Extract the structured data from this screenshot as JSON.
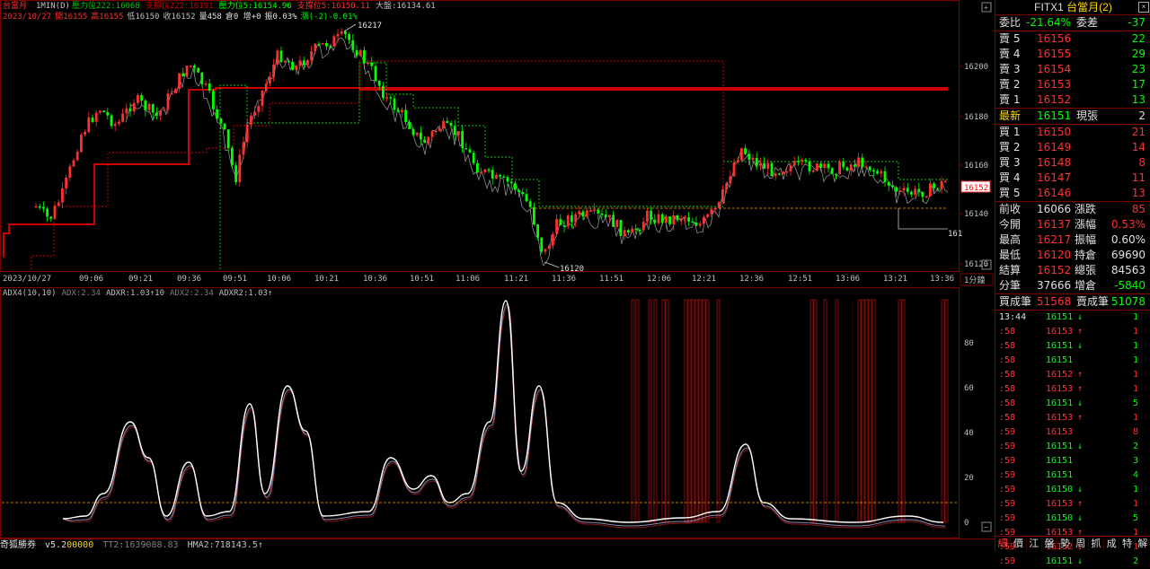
{
  "main": {
    "contract": "台當月",
    "interval": "1MIN(D)",
    "header_items": [
      {
        "text": "壓力位222:16068",
        "color": "#00c000"
      },
      {
        "text": "支撐位222:16191",
        "color": "#cc0000"
      },
      {
        "text": "壓力位5:16154.96",
        "color": "#00ff00"
      },
      {
        "text": "支撐位5:16150.11",
        "color": "#ff3030"
      },
      {
        "text": "大盤:16134.61",
        "color": "#c0c0c0"
      }
    ],
    "info_line": {
      "date": "2023/10/27",
      "open": "開16155",
      "high": "高16155",
      "low": "低16150",
      "close": "收16152",
      "volume": "量458",
      "oi": "倉0 增+0",
      "amplitude": "振0.03%",
      "change": "漲(-2)-0.01%"
    },
    "price_axis": [
      "16200",
      "16180",
      "16160",
      "16140",
      "16120"
    ],
    "time_axis": [
      "2023/10/27",
      "09:06",
      "09:21",
      "09:36",
      "09:51",
      "10:06",
      "10:21",
      "10:36",
      "10:51",
      "11:06",
      "11:21",
      "11:36",
      "11:51",
      "12:06",
      "12:21",
      "12:36",
      "12:51",
      "13:06",
      "13:21",
      "13:36"
    ],
    "interval_label": "1分鐘",
    "current_price_tag": "16152",
    "right_edge_label": "161",
    "high_marker": "16217",
    "low_marker": "16120"
  },
  "indicator": {
    "items": [
      {
        "text": "ADX4(10,10)",
        "color": "#c0c0c0"
      },
      {
        "text": "ADX:2.34",
        "color": "#808080"
      },
      {
        "text": "ADXR:1.03↑10",
        "color": "#c0c0c0"
      },
      {
        "text": "ADX2:2.34",
        "color": "#808080"
      },
      {
        "text": "ADXR2:1.03↑",
        "color": "#c0c0c0"
      }
    ],
    "axis": [
      "80",
      "60",
      "40",
      "20",
      "0"
    ]
  },
  "status": {
    "app": "奇狐勝券",
    "version": "v5.2",
    "version_suffix": "00000",
    "tt": "TT2:1639088.83",
    "hma": "HMA2:718143.5↑"
  },
  "panel": {
    "title_prefix": "FITX1",
    "title_name": "台當月(2)",
    "ratio": {
      "label1": "委比",
      "value1": "-21.64%",
      "label2": "委差",
      "value2": "-37"
    },
    "asks": [
      {
        "label": "賣 5",
        "price": "16156",
        "vol": "22"
      },
      {
        "label": "賣 4",
        "price": "16155",
        "vol": "29"
      },
      {
        "label": "賣 3",
        "price": "16154",
        "vol": "23"
      },
      {
        "label": "賣 2",
        "price": "16153",
        "vol": "17"
      },
      {
        "label": "賣 1",
        "price": "16152",
        "vol": "13"
      }
    ],
    "last": {
      "label": "最新",
      "price": "16151",
      "label2": "現張",
      "vol": "2"
    },
    "bids": [
      {
        "label": "買 1",
        "price": "16150",
        "vol": "21"
      },
      {
        "label": "買 2",
        "price": "16149",
        "vol": "14"
      },
      {
        "label": "買 3",
        "price": "16148",
        "vol": "8"
      },
      {
        "label": "買 4",
        "price": "16147",
        "vol": "11"
      },
      {
        "label": "買 5",
        "price": "16146",
        "vol": "13"
      }
    ],
    "stats": [
      {
        "l1": "前收",
        "v1": "16066",
        "c1": "#e0e0e0",
        "l2": "漲跌",
        "v2": "85",
        "c2": "#ff3030"
      },
      {
        "l1": "今開",
        "v1": "16137",
        "c1": "#ff3030",
        "l2": "漲幅",
        "v2": "0.53%",
        "c2": "#ff3030"
      },
      {
        "l1": "最高",
        "v1": "16217",
        "c1": "#ff3030",
        "l2": "振幅",
        "v2": "0.60%",
        "c2": "#e0e0e0"
      },
      {
        "l1": "最低",
        "v1": "16120",
        "c1": "#ff3030",
        "l2": "持倉",
        "v2": "69690",
        "c2": "#e0e0e0"
      },
      {
        "l1": "結算",
        "v1": "16152",
        "c1": "#ff3030",
        "l2": "總張",
        "v2": "84563",
        "c2": "#e0e0e0"
      },
      {
        "l1": "分筆",
        "v1": "37666",
        "c1": "#e0e0e0",
        "l2": "增倉",
        "v2": "-5840",
        "c2": "#00ff00"
      }
    ],
    "trade_summary": {
      "l1": "買成筆",
      "v1": "51568",
      "l2": "賣成筆",
      "v2": "51078"
    },
    "ticks": [
      {
        "time": "13:44",
        "price": "16151",
        "arrow": "↓",
        "vol": "1",
        "color": "#00ff00"
      },
      {
        "time": ":58",
        "price": "16153",
        "arrow": "↑",
        "vol": "1",
        "color": "#ff3030"
      },
      {
        "time": ":58",
        "price": "16151",
        "arrow": "↓",
        "vol": "1",
        "color": "#00ff00"
      },
      {
        "time": ":58",
        "price": "16151",
        "arrow": "",
        "vol": "1",
        "color": "#00ff00"
      },
      {
        "time": ":58",
        "price": "16152",
        "arrow": "↑",
        "vol": "1",
        "color": "#ff3030"
      },
      {
        "time": ":58",
        "price": "16153",
        "arrow": "↑",
        "vol": "1",
        "color": "#ff3030"
      },
      {
        "time": ":58",
        "price": "16151",
        "arrow": "↓",
        "vol": "5",
        "color": "#00ff00"
      },
      {
        "time": ":58",
        "price": "16153",
        "arrow": "↑",
        "vol": "1",
        "color": "#ff3030"
      },
      {
        "time": ":59",
        "price": "16153",
        "arrow": "",
        "vol": "8",
        "color": "#ff3030"
      },
      {
        "time": ":59",
        "price": "16151",
        "arrow": "↓",
        "vol": "2",
        "color": "#00ff00"
      },
      {
        "time": ":59",
        "price": "16151",
        "arrow": "",
        "vol": "3",
        "color": "#00ff00"
      },
      {
        "time": ":59",
        "price": "16151",
        "arrow": "",
        "vol": "4",
        "color": "#00ff00"
      },
      {
        "time": ":59",
        "price": "16150",
        "arrow": "↓",
        "vol": "1",
        "color": "#00ff00"
      },
      {
        "time": ":59",
        "price": "16153",
        "arrow": "↑",
        "vol": "1",
        "color": "#ff3030"
      },
      {
        "time": ":59",
        "price": "16150",
        "arrow": "↓",
        "vol": "5",
        "color": "#00ff00"
      },
      {
        "time": ":59",
        "price": "16153",
        "arrow": "↑",
        "vol": "1",
        "color": "#ff3030"
      },
      {
        "time": ":59",
        "price": "16152",
        "arrow": "↓",
        "vol": "1",
        "color": "#ff3030"
      },
      {
        "time": ":59",
        "price": "16151",
        "arrow": "↓",
        "vol": "2",
        "color": "#00ff00"
      }
    ],
    "tabs": [
      "細",
      "價",
      "江",
      "盤",
      "勢",
      "周",
      "抓",
      "成",
      "特",
      "解"
    ]
  },
  "colors": {
    "up": "#ff3030",
    "down": "#00ff00",
    "frame": "#800000",
    "resistance": "#cc0000",
    "gold": "#ffd700"
  }
}
